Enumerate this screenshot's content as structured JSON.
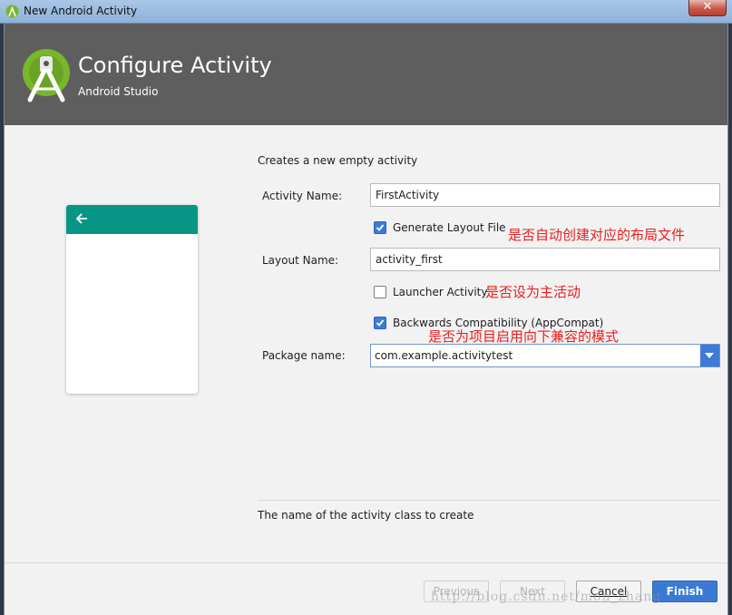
{
  "window": {
    "title": "New Android Activity",
    "close_glyph": "✕"
  },
  "header": {
    "title": "Configure Activity",
    "subtitle": "Android Studio",
    "bg_color": "#5e5e5e",
    "logo_color": "#78b72c"
  },
  "preview": {
    "appbar_color": "#079686",
    "icon": "back-arrow-icon"
  },
  "form": {
    "description": "Creates a new empty activity",
    "activity_name": {
      "label": "Activity Name:",
      "value": "FirstActivity"
    },
    "generate_layout": {
      "label": "Generate Layout File",
      "checked": true,
      "note": "是否自动创建对应的布局文件"
    },
    "layout_name": {
      "label": "Layout Name:",
      "value": "activity_first"
    },
    "launcher_activity": {
      "label": "Launcher Activity",
      "checked": false,
      "note": "是否设为主活动"
    },
    "backwards_compat": {
      "label": "Backwards Compatibility (AppCompat)",
      "checked": true,
      "note": "是否为项目启用向下兼容的模式"
    },
    "package_name": {
      "label": "Package name:",
      "value": "com.example.activitytest"
    },
    "hint": "The name of the activity class to create"
  },
  "buttons": {
    "previous": "Previous",
    "next": "Next",
    "cancel": "Cancel",
    "finish": "Finish"
  },
  "watermark": "http://blog.csdn.net/mon_zhang",
  "colors": {
    "accent": "#3a7ad4",
    "annotation": "#e8201d"
  }
}
